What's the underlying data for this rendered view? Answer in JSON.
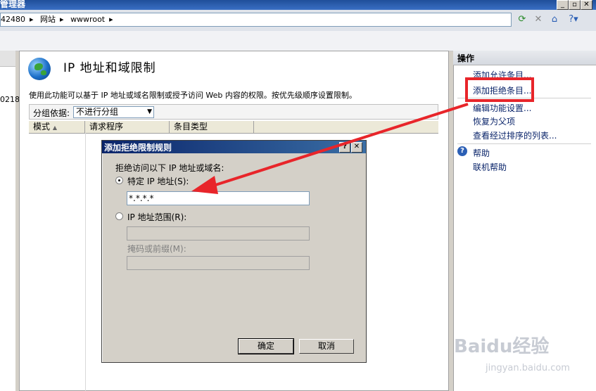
{
  "window": {
    "title": "管理器"
  },
  "address": {
    "crumbs": [
      "42480",
      "网站",
      "wwwroot"
    ]
  },
  "left": {
    "partial_text": "0218"
  },
  "main": {
    "title": "IP 地址和域限制",
    "description": "使用此功能可以基于 IP 地址或域名限制或授予访问 Web 内容的权限。按优先级顺序设置限制。",
    "group_label": "分组依据:",
    "group_value": "不进行分组",
    "columns": [
      "模式",
      "请求程序",
      "条目类型"
    ]
  },
  "actions": {
    "header": "操作",
    "items": [
      "添加允许条目...",
      "添加拒绝条目...",
      "编辑功能设置...",
      "恢复为父项",
      "查看经过排序的列表..."
    ],
    "help": "帮助",
    "online_help": "联机帮助"
  },
  "dialog": {
    "title": "添加拒绝限制规则",
    "prompt": "拒绝访问以下 IP 地址或域名:",
    "specific_ip_label": "特定 IP 地址(S):",
    "specific_ip_value": "*.*.*.*",
    "range_label": "IP 地址范围(R):",
    "mask_label": "掩码或前缀(M):",
    "ok": "确定",
    "cancel": "取消"
  },
  "watermark": {
    "brand": "Baidu经验",
    "url": "jingyan.baidu.com"
  },
  "colors": {
    "highlight": "#e8252a",
    "link": "#0a246a",
    "dialog_title": "#0a246a"
  }
}
